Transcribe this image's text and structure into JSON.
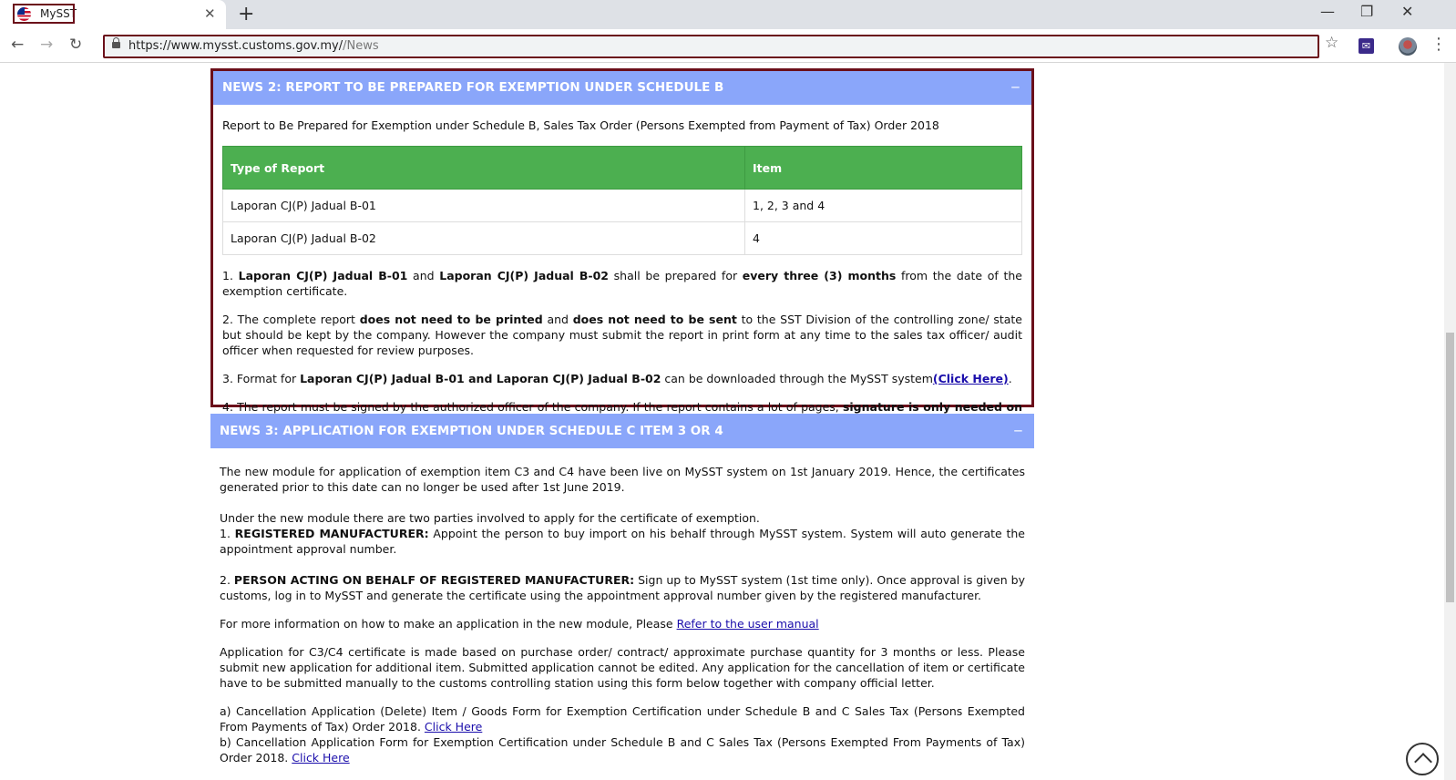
{
  "browser": {
    "tab_title": "MySST",
    "tab_close": "✕",
    "new_tab": "+",
    "url_host": "https://www.mysst.customs.gov.my/",
    "url_path": "/News",
    "minimize": "—",
    "restore": "❐",
    "close": "✕",
    "back": "←",
    "forward": "→",
    "reload": "↻",
    "star": "☆",
    "menu": "⋮",
    "ext_glyph": "✉"
  },
  "news2": {
    "title": "NEWS 2: REPORT TO BE PREPARED FOR EXEMPTION UNDER SCHEDULE B",
    "toggle": "−",
    "intro": "Report to Be Prepared for Exemption under Schedule B, Sales Tax Order (Persons Exempted from Payment of Tax) Order 2018",
    "table": {
      "headers": [
        "Type of Report",
        "Item"
      ],
      "rows": [
        [
          "Laporan CJ(P) Jadual B-01",
          "1, 2, 3 and 4"
        ],
        [
          "Laporan CJ(P) Jadual B-02",
          "4"
        ]
      ]
    },
    "p1": {
      "a": "1. ",
      "b": "Laporan CJ(P) Jadual B-01",
      "c": " and ",
      "d": "Laporan CJ(P) Jadual B-02",
      "e": " shall be prepared for ",
      "f": "every three (3) months",
      "g": " from the date of the exemption certificate."
    },
    "p2": {
      "a": "2. The complete report ",
      "b": "does not need to be printed",
      "c": " and ",
      "d": "does not need to be sent",
      "e": " to the SST Division of the controlling zone/ state but should be kept by the company. However the company must submit the report in print form at any time to the sales tax officer/ audit officer when requested for review purposes."
    },
    "p3": {
      "a": "3. Format for ",
      "b": "Laporan CJ(P) Jadual B-01 and Laporan CJ(P) Jadual B-02",
      "c": " can be downloaded through the MySST system",
      "link": "(Click Here)",
      "d": "."
    },
    "p4": {
      "a": "4. The report must be signed by the authorized officer of the company. If the report contains a lot of pages, ",
      "b": "signature is only needed on the last page of the report which contains grand total information."
    }
  },
  "news3": {
    "title": "NEWS 3: APPLICATION FOR EXEMPTION UNDER SCHEDULE C ITEM 3 OR 4",
    "toggle": "−",
    "p1": "The new module for application of exemption item C3 and C4 have been live on MySST system on 1st January 2019. Hence, the certificates generated prior to this date can no longer be used after 1st June 2019.",
    "p2": "Under the new module there are two parties involved to apply for the certificate of exemption.",
    "p3": {
      "a": "1. ",
      "b": "REGISTERED MANUFACTURER:",
      "c": " Appoint the person to buy import on his behalf through MySST system. System will auto generate the appointment approval number."
    },
    "p4": {
      "a": "2. ",
      "b": "PERSON ACTING ON BEHALF OF REGISTERED MANUFACTURER:",
      "c": " Sign up to MySST system (1st time only). Once approval is given by customs, log in to MySST and generate the certificate using the appointment approval number given by the registered manufacturer."
    },
    "p5": {
      "a": "For more information on how to make an application in the new module, Please ",
      "link": "Refer to the user manual"
    },
    "p6": "Application for C3/C4 certificate is made based on purchase order/ contract/ approximate purchase quantity for 3 months or less. Please submit new application for additional item. Submitted application cannot be edited. Any application for the cancellation of item or certificate have to be submitted manually to the customs controlling station using this form below together with company official letter.",
    "p7": {
      "a": "a) Cancellation Application (Delete) Item / Goods Form for Exemption Certification under Schedule B and C Sales Tax (Persons Exempted From Payments of Tax) Order 2018. ",
      "link": "Click Here"
    },
    "p8": {
      "a": "b) Cancellation Application Form for Exemption Certification under Schedule B and C Sales Tax (Persons Exempted From Payments of Tax) Order 2018. ",
      "link": "Click Here"
    }
  }
}
